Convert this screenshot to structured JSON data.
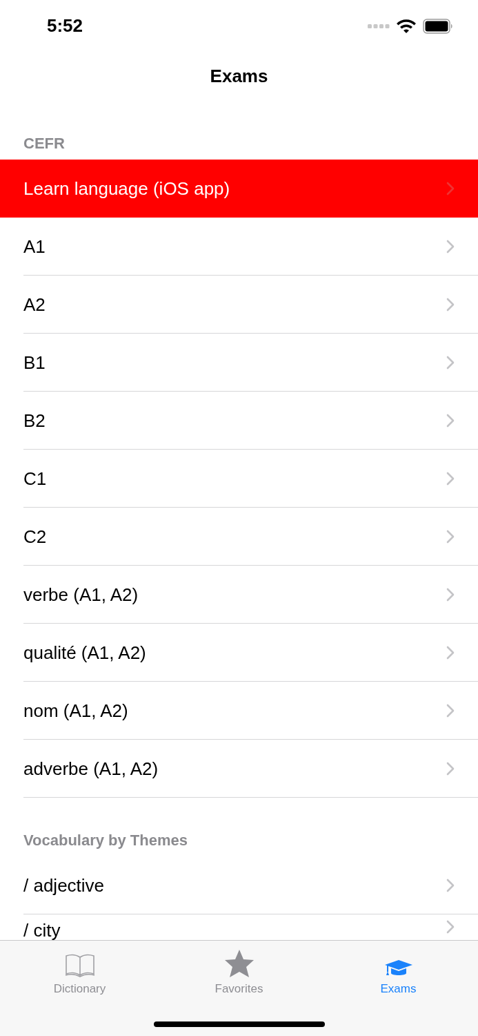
{
  "status_bar": {
    "time": "5:52"
  },
  "nav": {
    "title": "Exams"
  },
  "sections": [
    {
      "header": "CEFR",
      "rows": [
        {
          "label": "Learn language (iOS app)",
          "kind": "promo"
        },
        {
          "label": "A1",
          "kind": "plain"
        },
        {
          "label": "A2",
          "kind": "plain"
        },
        {
          "label": "B1",
          "kind": "plain"
        },
        {
          "label": "B2",
          "kind": "plain"
        },
        {
          "label": "C1",
          "kind": "plain"
        },
        {
          "label": "C2",
          "kind": "plain"
        },
        {
          "label": "verbe (A1, A2)",
          "kind": "plain"
        },
        {
          "label": "qualité (A1, A2)",
          "kind": "plain"
        },
        {
          "label": "nom (A1, A2)",
          "kind": "plain"
        },
        {
          "label": "adverbe (A1, A2)",
          "kind": "plain"
        }
      ]
    },
    {
      "header": "Vocabulary by Themes",
      "rows": [
        {
          "label": "/ adjective",
          "kind": "plain"
        },
        {
          "label": "/ city",
          "kind": "plain"
        }
      ]
    }
  ],
  "tabs": [
    {
      "label": "Dictionary",
      "kind": "book",
      "selected": false
    },
    {
      "label": "Favorites",
      "kind": "star",
      "selected": false
    },
    {
      "label": "Exams",
      "kind": "cap",
      "selected": true
    }
  ]
}
